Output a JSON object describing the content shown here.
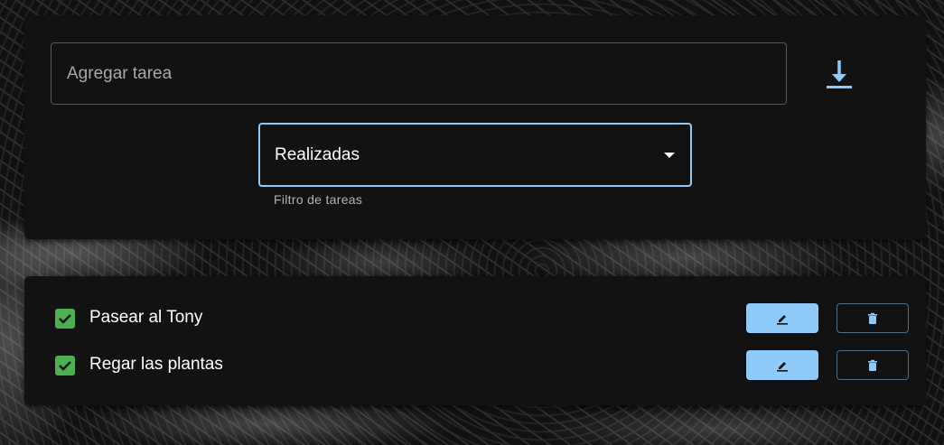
{
  "add_task": {
    "placeholder": "Agregar tarea",
    "save_icon": "download-icon"
  },
  "filter": {
    "selected": "Realizadas",
    "helper": "Filtro de tareas",
    "icon": "caret-down-icon"
  },
  "tasks": [
    {
      "label": "Pasear al Tony",
      "done": true
    },
    {
      "label": "Regar las plantas",
      "done": true
    }
  ],
  "task_actions": {
    "edit_icon": "pencil-icon",
    "delete_icon": "trash-icon"
  },
  "colors": {
    "accent": "#90caf9",
    "checkbox": "#4caf50",
    "card": "#121212",
    "text": "#ffffff"
  }
}
